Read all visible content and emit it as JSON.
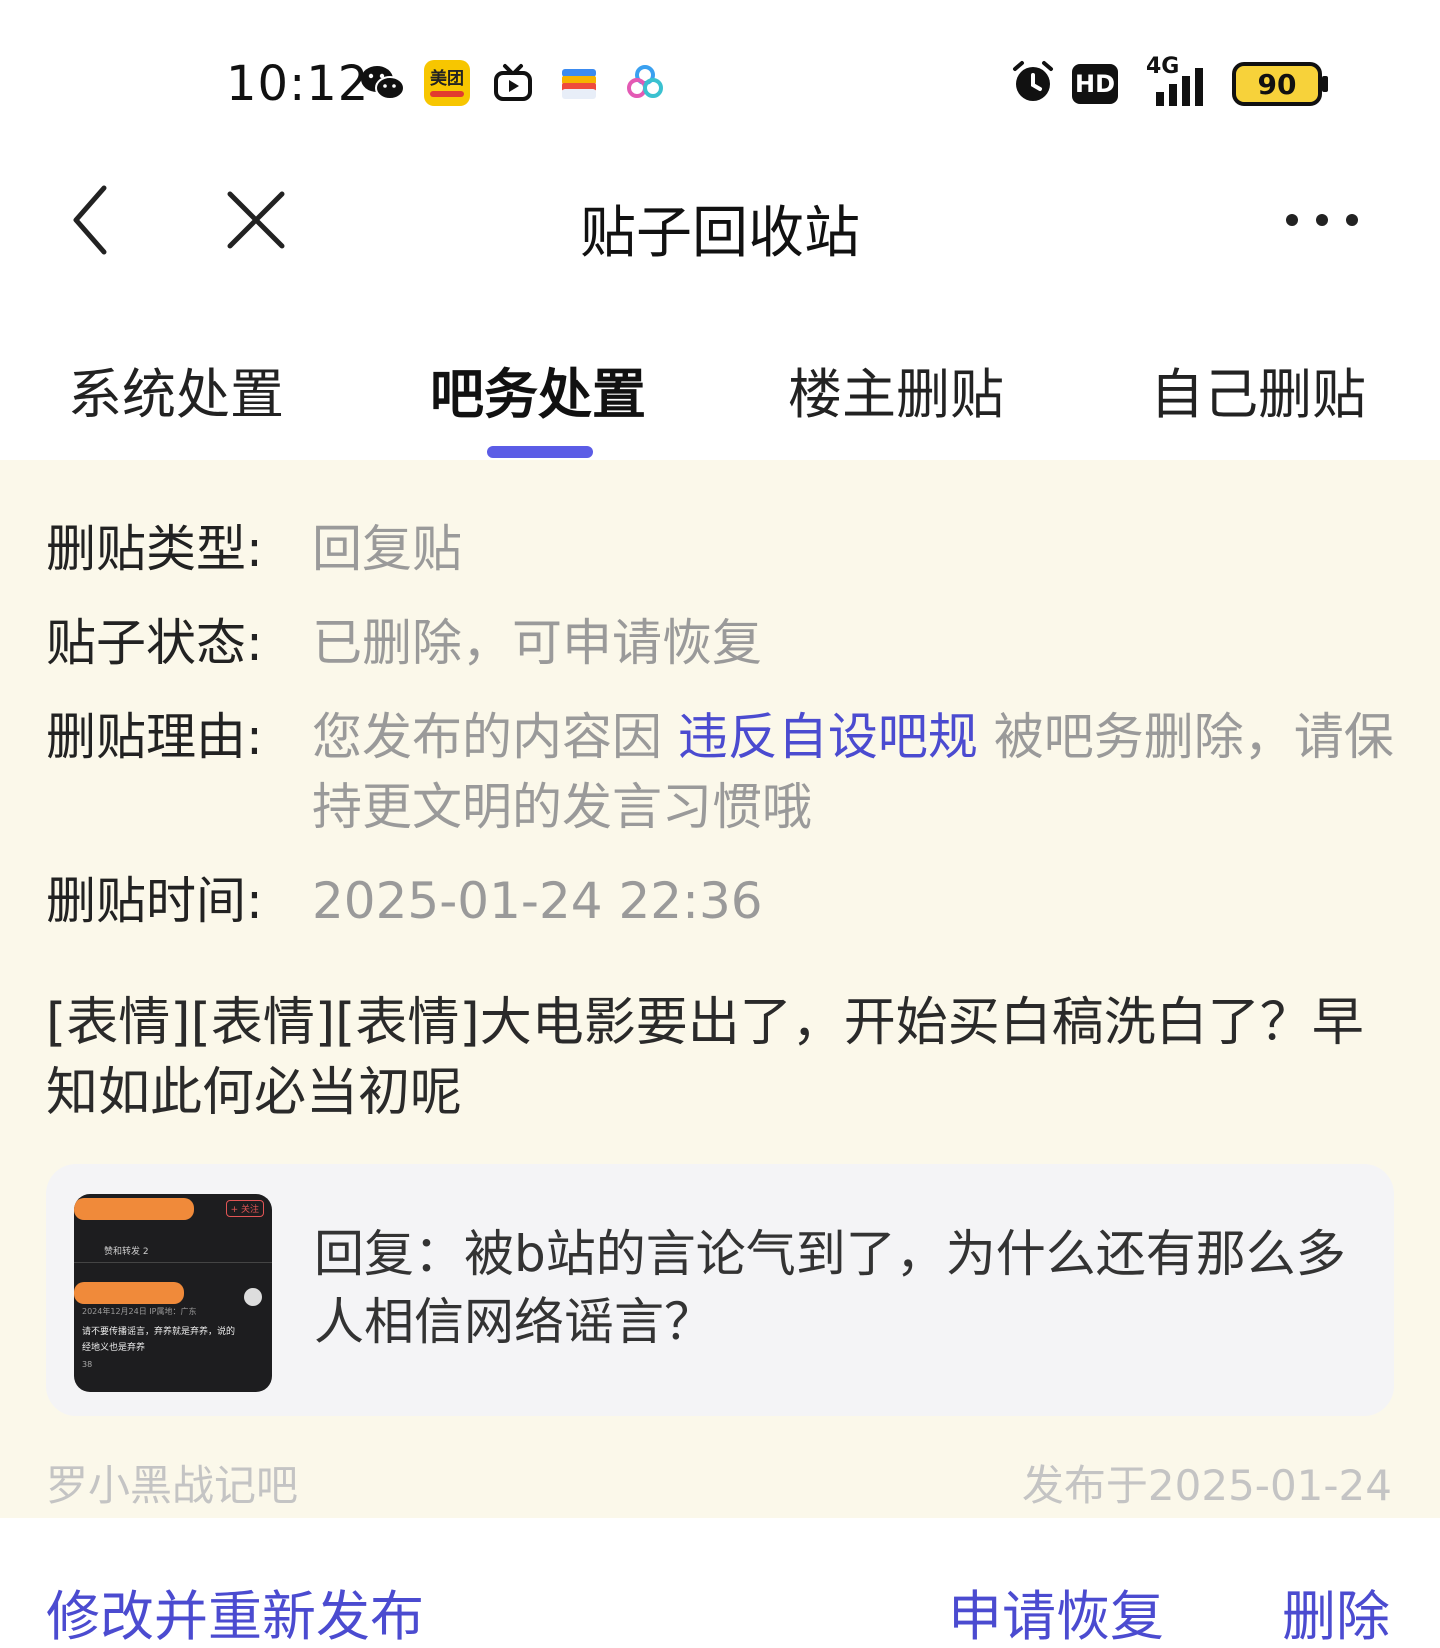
{
  "status_bar": {
    "time": "10:12",
    "meituan_label": "美团",
    "hd_label": "HD",
    "network_label": "4G",
    "battery": "90"
  },
  "nav": {
    "title": "贴子回收站"
  },
  "tabs": [
    {
      "label": "系统处置",
      "active": false
    },
    {
      "label": "吧务处置",
      "active": true
    },
    {
      "label": "楼主删贴",
      "active": false
    },
    {
      "label": "自己删贴",
      "active": false
    }
  ],
  "details": {
    "type_label": "删贴类型:",
    "type_value": "回复贴",
    "status_label": "贴子状态:",
    "status_value": "已删除，可申请恢复",
    "reason_label": "删贴理由:",
    "reason_prefix": "您发布的内容因 ",
    "reason_link": "违反自设吧规",
    "reason_suffix": " 被吧务删除，请保持更文明的发言习惯哦",
    "time_label": "删贴时间:",
    "time_value": "2025-01-24 22:36"
  },
  "post": {
    "text": "[表情][表情][表情]大电影要出了，开始买白稿洗白了？早知如此何必当初呢"
  },
  "quote": {
    "text": "回复：被b站的言论气到了，为什么还有那么多人相信网络谣言？",
    "thumb_follow": "+ 关注",
    "thumb_tab": "赞和转发 2",
    "thumb_date": "2024年12月24日 IP属地：广东",
    "thumb_line1": "请不要传播谣言，弃养就是弃养，说的",
    "thumb_line2": "经地义也是弃养",
    "thumb_likes": "38"
  },
  "meta": {
    "forum": "罗小黑战记吧",
    "published": "发布于2025-01-24"
  },
  "actions": {
    "edit": "修改并重新发布",
    "restore": "申请恢复",
    "delete": "删除"
  },
  "colors": {
    "accent": "#4b4bd0",
    "indicator": "#5b5ce6",
    "content_bg": "#fbf8ea"
  }
}
